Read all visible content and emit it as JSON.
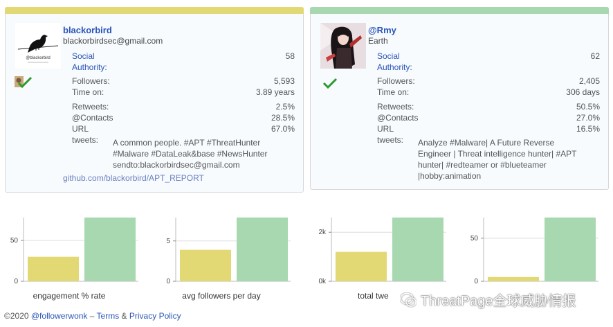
{
  "profiles": [
    {
      "username": "blackorbird",
      "subline": "blackorbirdsec@gmail.com",
      "avatar_caption": "@blackorbird",
      "social_authority_label1": "Social",
      "social_authority_label2": "Authority:",
      "social_authority": "58",
      "followers_label": "Followers:",
      "followers": "5,593",
      "time_on_label": "Time on:",
      "time_on": "3.89 years",
      "retweets_label": "Retweets:",
      "retweets": "2.5%",
      "contacts_label": "@Contacts",
      "contacts": "28.5%",
      "url_label": "URL",
      "url_pct": "67.0%",
      "tweets_label": "tweets:",
      "bio_lines": [
        "A common people. #APT #ThreatHunter",
        "#Malware #DataLeak&base #NewsHunter",
        "sendto:blackorbirdsec@gmail.com"
      ],
      "link": "github.com/blackorbird/APT_REPORT",
      "color": "#e3d974"
    },
    {
      "username": "@Rmy",
      "subline": "Earth",
      "social_authority_label1": "Social",
      "social_authority_label2": "Authority:",
      "social_authority": "62",
      "followers_label": "Followers:",
      "followers": "2,405",
      "time_on_label": "Time on:",
      "time_on": "306 days",
      "retweets_label": "Retweets:",
      "retweets": "50.5%",
      "contacts_label": "@Contacts",
      "contacts": "27.0%",
      "url_label": "URL",
      "url_pct": "16.5%",
      "tweets_label": "tweets:",
      "bio_lines": [
        "Analyze #Malware| A Future Reverse",
        "Engineer | Threat intelligence hunter| #APT",
        "hunter| #redteamer or #blueteamer",
        "|hobby:animation"
      ],
      "color": "#a8d8b0"
    }
  ],
  "chart_data": [
    {
      "type": "bar",
      "categories": [
        "blackorbird",
        "@Rmy"
      ],
      "values": [
        30,
        78
      ],
      "xlabel": "engagement % rate",
      "ylim": [
        0,
        78
      ],
      "yticks": [
        0,
        50
      ],
      "ytick_labels": [
        "0",
        "50"
      ],
      "colors": [
        "#e3d974",
        "#a8d8b0"
      ]
    },
    {
      "type": "bar",
      "categories": [
        "blackorbird",
        "@Rmy"
      ],
      "values": [
        3.9,
        7.9
      ],
      "xlabel": "avg followers per day",
      "ylim": [
        0,
        7.9
      ],
      "yticks": [
        0,
        5
      ],
      "ytick_labels": [
        "0",
        "5"
      ],
      "colors": [
        "#e3d974",
        "#a8d8b0"
      ]
    },
    {
      "type": "bar",
      "categories": [
        "blackorbird",
        "@Rmy"
      ],
      "values": [
        1200,
        2600
      ],
      "xlabel": "total twe",
      "ylim": [
        0,
        2600
      ],
      "yticks": [
        0,
        2000
      ],
      "ytick_labels": [
        "0k",
        "2k"
      ],
      "colors": [
        "#e3d974",
        "#a8d8b0"
      ]
    },
    {
      "type": "bar",
      "categories": [
        "blackorbird",
        "@Rmy"
      ],
      "values": [
        5,
        74
      ],
      "xlabel": "",
      "ylim": [
        0,
        74
      ],
      "yticks": [
        0,
        50
      ],
      "ytick_labels": [
        "0",
        "50"
      ],
      "colors": [
        "#e3d974",
        "#a8d8b0"
      ]
    }
  ],
  "footer": {
    "copyright": "©2020 ",
    "handle": "@followerwonk",
    "dash": " – ",
    "terms": "Terms",
    "amp": " & ",
    "privacy": "Privacy Policy"
  },
  "watermark": {
    "text": "ThreatPage全球威胁情报"
  }
}
